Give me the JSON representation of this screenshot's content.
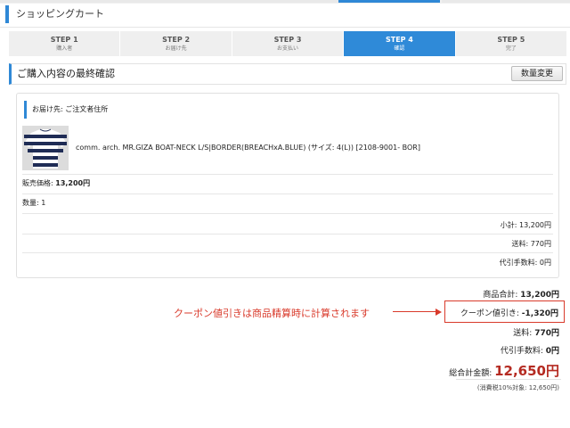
{
  "header": {
    "title": "ショッピングカート"
  },
  "steps": [
    {
      "step": "STEP 1",
      "label": "購入者"
    },
    {
      "step": "STEP 2",
      "label": "お届け先"
    },
    {
      "step": "STEP 3",
      "label": "お支払い"
    },
    {
      "step": "STEP 4",
      "label": "確認",
      "active": true
    },
    {
      "step": "STEP 5",
      "label": "完了"
    }
  ],
  "colors": {
    "accent": "#2f88d6",
    "active_step": "#2f8ad8",
    "annotation": "#d93a2b",
    "total": "#b52b22"
  },
  "confirm": {
    "title": "ご購入内容の最終確認",
    "qty_button": "数量変更"
  },
  "order": {
    "ship_label": "お届け先: ご注文者住所",
    "product_name": "comm. arch. MR.GIZA BOAT-NECK L/S|BORDER(BREACHxA.BLUE) (サイズ: 4(L)) [2108-9001- BOR]",
    "price_label": "販売価格:",
    "price_value": "13,200円",
    "qty_label": "数量:",
    "qty_value": "1",
    "subtotal": "小計: 13,200円",
    "shipping": "送料: 770円",
    "cod_fee": "代引手数料: 0円"
  },
  "summary": {
    "goods_total_label": "商品合計:",
    "goods_total_value": "13,200円",
    "coupon_label": "クーポン値引き:",
    "coupon_value": "-1,320円",
    "shipping_label": "送料:",
    "shipping_value": "770円",
    "cod_label": "代引手数料:",
    "cod_value": "0円",
    "grand_label": "総合計金額:",
    "grand_value": "12,650円",
    "tax_note": "(消費税10%対象: 12,650円)"
  },
  "annotation": {
    "text": "クーポン値引きは商品精算時に計算されます"
  },
  "icons": {
    "product_thumbnail": "striped-shirt-image",
    "arrow": "arrow-right-icon"
  }
}
